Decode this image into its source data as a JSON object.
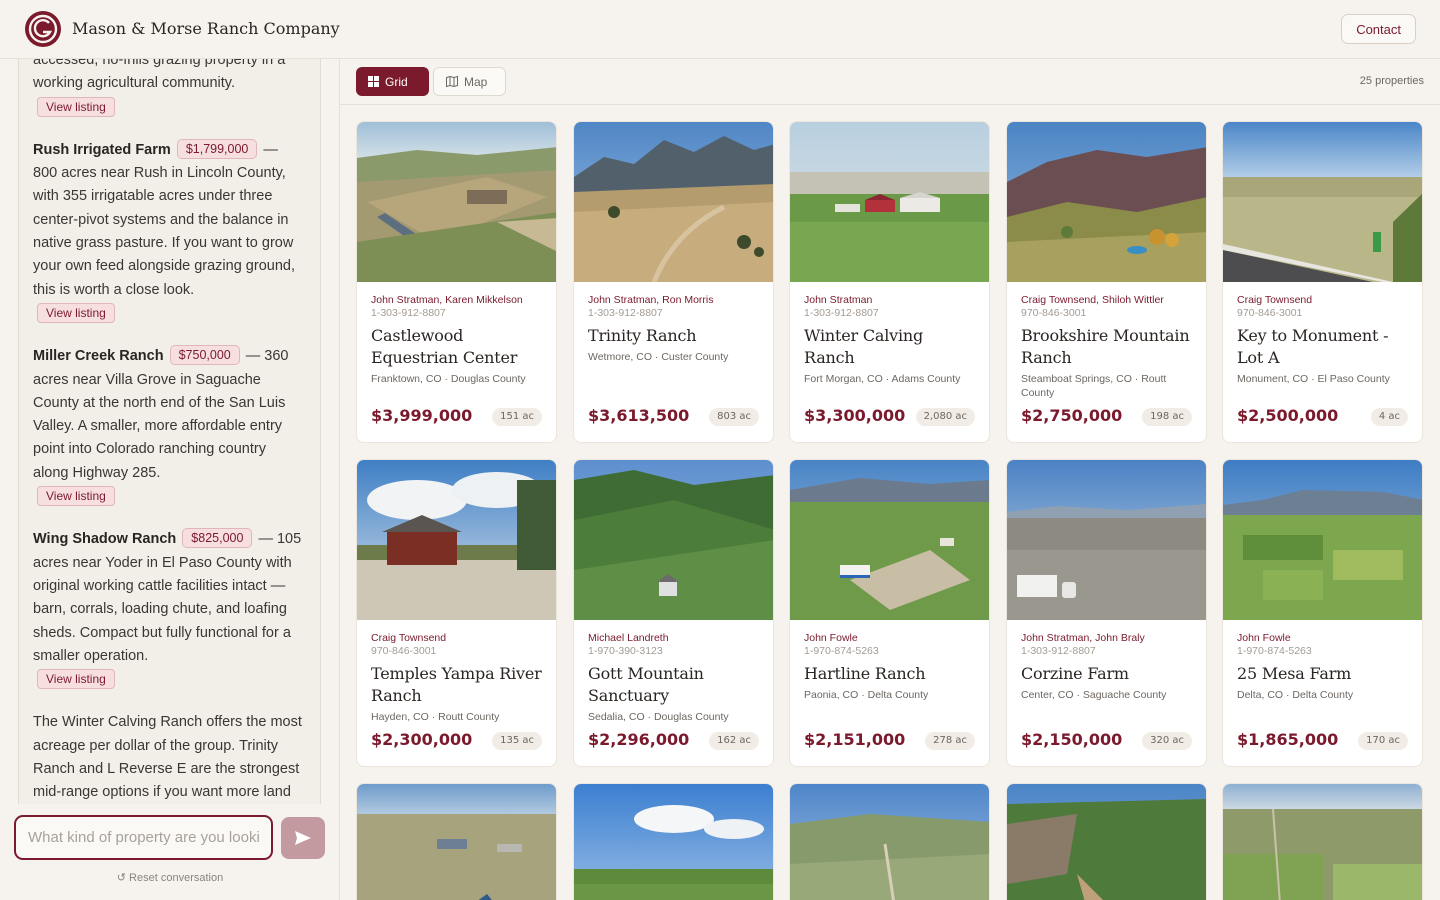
{
  "header": {
    "brand": "Mason & Morse Ranch Company",
    "contact_label": "Contact"
  },
  "chat": {
    "messages": [
      {
        "type": "text",
        "text": "accessed, no-frills grazing property in a working agricultural community."
      },
      {
        "type": "listing",
        "name": "Rush Irrigated Farm",
        "price": "$1,799,000",
        "text": " — 800 acres near Rush in Lincoln County, with 355 irrigatable acres under three center-pivot systems and the balance in native grass pasture. If you want to grow your own feed alongside grazing ground, this is worth a close look."
      },
      {
        "type": "listing",
        "name": "Miller Creek Ranch",
        "price": "$750,000",
        "text": " — 360 acres near Villa Grove in Saguache County at the north end of the San Luis Valley. A smaller, more affordable entry point into Colorado ranching country along Highway 285."
      },
      {
        "type": "listing",
        "name": "Wing Shadow Ranch",
        "price": "$825,000",
        "text": " — 105 acres near Yoder in El Paso County with original working cattle facilities intact — barn, corrals, loading chute, and loafing sheds. Compact but fully functional for a smaller operation."
      },
      {
        "type": "text",
        "text": "The Winter Calving Ranch offers the most acreage per dollar of the group. Trinity Ranch and L Reverse E are the strongest mid-range options if you want more land"
      }
    ],
    "view_listing_label": "View listing",
    "input_placeholder": "What kind of property are you looking for?",
    "reset_label": "↺ Reset conversation"
  },
  "toolbar": {
    "grid_label": "Grid",
    "map_label": "Map",
    "count": "25 properties"
  },
  "cards": [
    {
      "agents": [
        "John Stratman",
        "Karen Mikkelson"
      ],
      "phone": "1-303-912-8807",
      "title": "Castlewood Equestrian Center",
      "location": "Franktown, CO · Douglas County",
      "price": "$3,999,000",
      "acres": "151 ac",
      "scene": "equestrian"
    },
    {
      "agents": [
        "John Stratman",
        "Ron Morris"
      ],
      "phone": "1-303-912-8807",
      "title": "Trinity Ranch",
      "location": "Wetmore, CO · Custer County",
      "price": "$3,613,500",
      "acres": "803 ac",
      "scene": "mountain-dry"
    },
    {
      "agents": [
        "John Stratman"
      ],
      "phone": "1-303-912-8807",
      "title": "Winter Calving Ranch",
      "location": "Fort Morgan, CO · Adams County",
      "price": "$3,300,000",
      "acres": "2,080 ac",
      "scene": "plains-barn"
    },
    {
      "agents": [
        "Craig Townsend",
        "Shiloh Wittler"
      ],
      "phone": "970-846-3001",
      "title": "Brookshire Mountain Ranch",
      "location": "Steamboat Springs, CO · Routt County",
      "price": "$2,750,000",
      "acres": "198 ac",
      "scene": "hill-autumn"
    },
    {
      "agents": [
        "Craig Townsend"
      ],
      "phone": "970-846-3001",
      "title": "Key to Monument - Lot A",
      "location": "Monument, CO · El Paso County",
      "price": "$2,500,000",
      "acres": "4 ac",
      "scene": "lot-road"
    },
    {
      "agents": [
        "Craig Townsend"
      ],
      "phone": "970-846-3001",
      "title": "Temples Yampa River Ranch",
      "location": "Hayden, CO · Routt County",
      "price": "$2,300,000",
      "acres": "135 ac",
      "scene": "house-clouds"
    },
    {
      "agents": [
        "Michael Landreth"
      ],
      "phone": "1-970-390-3123",
      "title": "Gott Mountain Sanctuary",
      "location": "Sedalia, CO · Douglas County",
      "price": "$2,296,000",
      "acres": "162 ac",
      "scene": "forest"
    },
    {
      "agents": [
        "John Fowle"
      ],
      "phone": "1-970-874-5263",
      "title": "Hartline Ranch",
      "location": "Paonia, CO · Delta County",
      "price": "$2,151,000",
      "acres": "278 ac",
      "scene": "valley-green"
    },
    {
      "agents": [
        "John Stratman",
        "John Braly"
      ],
      "phone": "1-303-912-8807",
      "title": "Corzine Farm",
      "location": "Center, CO · Saguache County",
      "price": "$2,150,000",
      "acres": "320 ac",
      "scene": "flat-bare"
    },
    {
      "agents": [
        "John Fowle"
      ],
      "phone": "1-970-874-5263",
      "title": "25 Mesa Farm",
      "location": "Delta, CO · Delta County",
      "price": "$1,865,000",
      "acres": "170 ac",
      "scene": "mesa-fields"
    },
    {
      "agents": [],
      "phone": "",
      "title": "",
      "location": "",
      "price": "",
      "acres": "",
      "scene": "prairie-buildings"
    },
    {
      "agents": [],
      "phone": "",
      "title": "",
      "location": "",
      "price": "",
      "acres": "",
      "scene": "green-field-sky"
    },
    {
      "agents": [],
      "phone": "",
      "title": "",
      "location": "",
      "price": "",
      "acres": "",
      "scene": "valley-road"
    },
    {
      "agents": [],
      "phone": "",
      "title": "",
      "location": "",
      "price": "",
      "acres": "",
      "scene": "rocky-trees"
    },
    {
      "agents": [],
      "phone": "",
      "title": "",
      "location": "",
      "price": "",
      "acres": "",
      "scene": "farmland-aerial"
    }
  ],
  "colors": {
    "accent": "#7a1a2c",
    "background": "#f6f3ee",
    "card": "#ffffff"
  }
}
